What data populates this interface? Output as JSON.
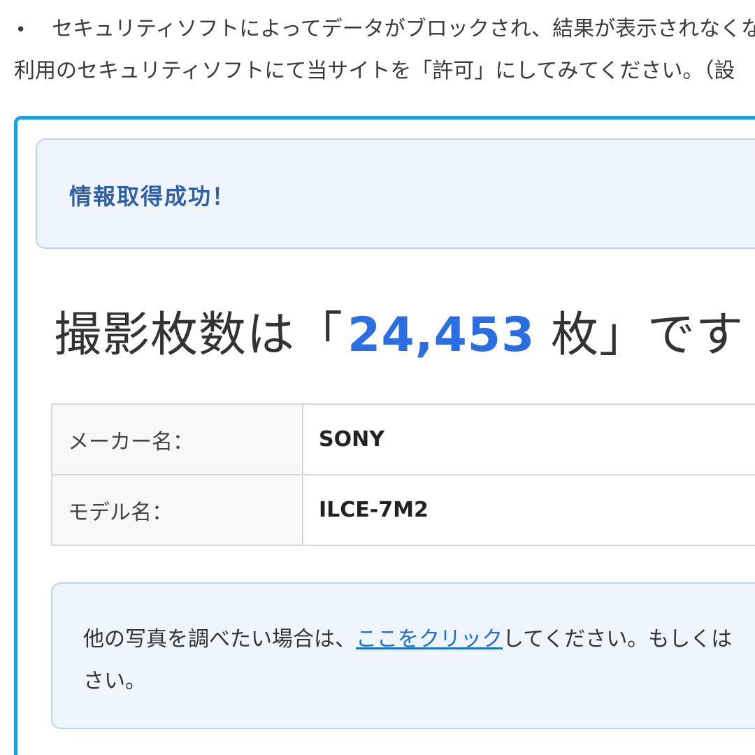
{
  "notice": {
    "bullet": "•",
    "line1": "セキュリティソフトによってデータがブロックされ、結果が表示されなくな",
    "line2": "利用のセキュリティソフトにて当サイトを「許可」にしてみてください。（設"
  },
  "result": {
    "success_message": "情報取得成功！",
    "count": {
      "prefix": "撮影枚数は「",
      "number": "24,453",
      "unit": " 枚",
      "suffix": "」です"
    },
    "table": {
      "rows": [
        {
          "label": "メーカー名：",
          "value": "SONY"
        },
        {
          "label": "モデル名：",
          "value": "ILCE-7M2"
        }
      ]
    },
    "info": {
      "text_before_link": "他の写真を調べたい場合は、",
      "link_text": "ここをクリック",
      "text_after_link": "してください。もしくは",
      "line2": "さい。"
    }
  },
  "colors": {
    "card_border": "#1aa1e5",
    "alert_background": "#eef5fd",
    "alert_border": "#b9d6f2",
    "success_text": "#2f5fa6",
    "count_highlight": "#2b6ee2",
    "link": "#1f6fd0"
  }
}
